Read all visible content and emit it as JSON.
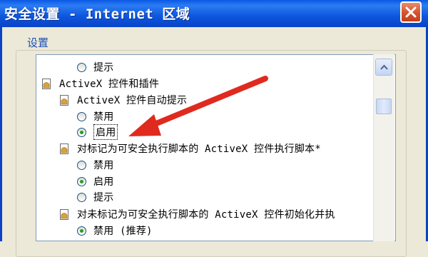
{
  "window": {
    "title": "安全设置 - Internet 区域",
    "close_icon": "close-icon",
    "titlebar_color": "#0A58E4",
    "close_button_color": "#D6512C"
  },
  "settings_group": {
    "label": "设置"
  },
  "settings_list": {
    "rows": [
      {
        "type": "radio",
        "label": "提示",
        "checked": false
      },
      {
        "type": "category",
        "label": "ActiveX 控件和插件"
      },
      {
        "type": "category",
        "label": "ActiveX 控件自动提示"
      },
      {
        "type": "radio",
        "label": "禁用",
        "checked": false
      },
      {
        "type": "radio",
        "label": "启用",
        "checked": true
      },
      {
        "type": "category",
        "label": "对标记为可安全执行脚本的 ActiveX 控件执行脚本*"
      },
      {
        "type": "radio",
        "label": "禁用",
        "checked": false
      },
      {
        "type": "radio",
        "label": "启用",
        "checked": true
      },
      {
        "type": "radio",
        "label": "提示",
        "checked": false
      },
      {
        "type": "category",
        "label": "对未标记为可安全执行脚本的 ActiveX 控件初始化并执"
      },
      {
        "type": "radio",
        "label": "禁用 (推荐)",
        "checked": true
      }
    ]
  },
  "annotation": {
    "arrow_color": "#E02A1F"
  }
}
